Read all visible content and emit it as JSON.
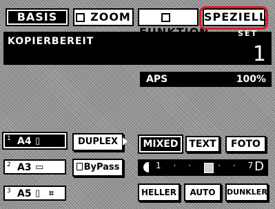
{
  "tabs": [
    {
      "label": "BASIS"
    },
    {
      "label": "ZOOM"
    },
    {
      "label": "FUNKTION"
    },
    {
      "label": "SPEZIELL"
    }
  ],
  "copy_area": {
    "label": "KOPIERBEREIT",
    "set_label": "SET",
    "count": "1"
  },
  "status": {
    "mode": "APS",
    "zoom": "100%"
  },
  "paper_trays": [
    {
      "index": "1",
      "size": "A4",
      "glyph": "▯",
      "extra": ""
    },
    {
      "index": "2",
      "size": "A3",
      "glyph": "▭",
      "extra": ""
    },
    {
      "index": "3",
      "size": "A5",
      "glyph": "▯",
      "extra": "⌗"
    }
  ],
  "options": {
    "duplex": "DUPLEX",
    "bypass": "ByPass"
  },
  "image_mode": {
    "mixed": "MIXED",
    "text": "TEXT",
    "photo": "FOTO"
  },
  "density": {
    "dots": "1 · · · · · 7",
    "dark_letter": "D",
    "heller": "HELLER",
    "auto": "AUTO",
    "dunkler": "DUNKLER"
  },
  "colors": {
    "highlight": "#e0182a",
    "pattern": "#9a9a9a"
  }
}
